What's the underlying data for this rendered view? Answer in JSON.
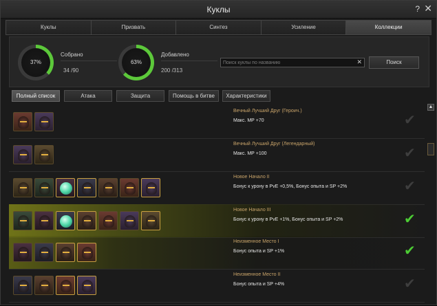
{
  "window": {
    "title": "Куклы",
    "help_label": "?",
    "close_label": "✕"
  },
  "tabs": [
    {
      "label": "Куклы",
      "active": false
    },
    {
      "label": "Призвать",
      "active": false
    },
    {
      "label": "Синтез",
      "active": false
    },
    {
      "label": "Усиление",
      "active": false
    },
    {
      "label": "Коллекции",
      "active": true
    }
  ],
  "stats": {
    "collected": {
      "percent_label": "37%",
      "label": "Собрано",
      "count": "34 /90",
      "fraction": 0.37
    },
    "added": {
      "percent_label": "63%",
      "label": "Добавлено",
      "count": "200 /313",
      "fraction": 0.63
    },
    "ring_color": "#5cc83a"
  },
  "search": {
    "placeholder": "Поиск куклы по названию",
    "value": "",
    "clear_label": "✕",
    "button_label": "Поиск"
  },
  "filters": [
    {
      "label": "Полный список",
      "active": true
    },
    {
      "label": "Атака",
      "active": false
    },
    {
      "label": "Защита",
      "active": false
    },
    {
      "label": "Помощь в битве",
      "active": false
    },
    {
      "label": "Характеристики",
      "active": false
    }
  ],
  "collections": [
    {
      "name": "Вечный Лучший Друг (Героич.)",
      "bonus": "Макс. МР +70",
      "completed": false,
      "highlight": "none",
      "doll_count": 2
    },
    {
      "name": "Вечный Лучший Друг (Легендарный)",
      "bonus": "Макс. МР +100",
      "completed": false,
      "highlight": "none",
      "doll_count": 2
    },
    {
      "name": "Новое Начало II",
      "bonus": "Бонус к урону в PvE +0,5%, Бонус опыта и SP +2%",
      "completed": false,
      "highlight": "none",
      "doll_count": 7
    },
    {
      "name": "Новое Начало III",
      "bonus": "Бонус к урону в PvE +1%, Бонус опыта и SP +2%",
      "completed": true,
      "highlight": "full",
      "doll_count": 7
    },
    {
      "name": "Неизменное Место I",
      "bonus": "Бонус опыта и SP +1%",
      "completed": true,
      "highlight": "lite",
      "doll_count": 4
    },
    {
      "name": "Неизменное Место II",
      "bonus": "Бонус опыта и SP +4%",
      "completed": false,
      "highlight": "none",
      "doll_count": 4
    }
  ],
  "check_glyph": "✔",
  "scroll": {
    "up_label": "▲"
  }
}
